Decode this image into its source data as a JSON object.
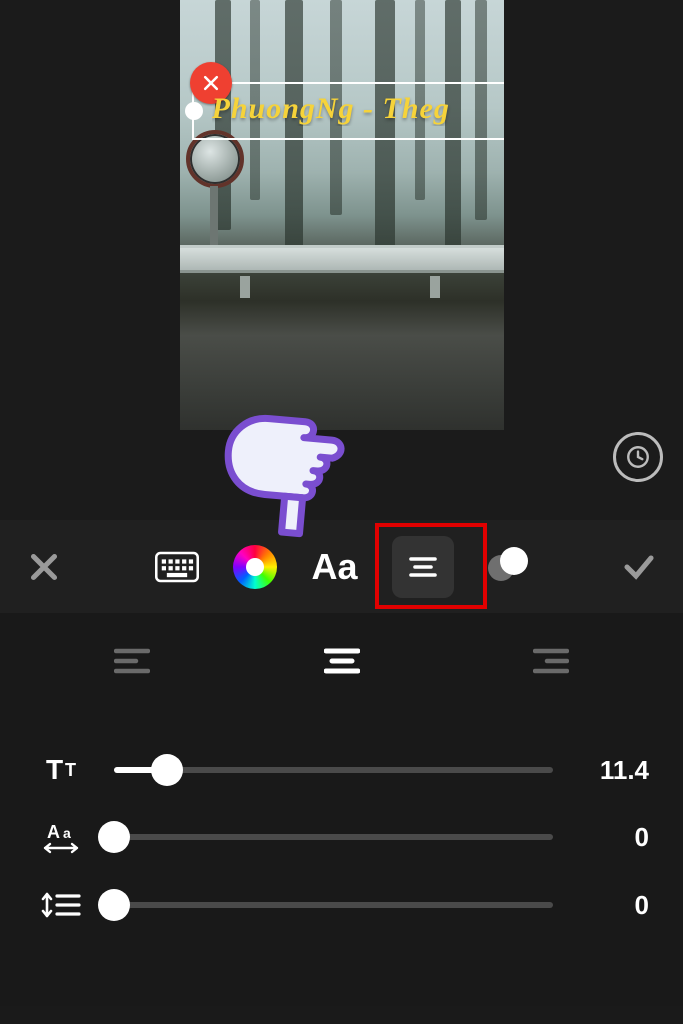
{
  "overlay": {
    "text": "PhuongNg - Theg",
    "text_color": "#f6d33a"
  },
  "icons": {
    "close_overlay": "close-icon",
    "grip": "handle-icon",
    "hand_pointer": "pointing-hand-icon",
    "clock": "clock-icon",
    "toolbar_close": "close-icon",
    "keyboard": "keyboard-icon",
    "color_wheel": "color-wheel-icon",
    "font": "font-icon",
    "align": "align-center-icon",
    "opacity": "opacity-icon",
    "confirm": "checkmark-icon",
    "align_left": "align-left-icon",
    "align_center": "align-center-icon",
    "align_right": "align-right-icon",
    "text_size": "text-size-icon",
    "letter_spacing": "letter-spacing-icon",
    "line_height": "line-height-icon"
  },
  "toolbar": {
    "font_label": "Aa"
  },
  "alignment": {
    "selected": "center"
  },
  "sliders": {
    "text_size": {
      "value": "11.4",
      "percent": 12
    },
    "letter_spacing": {
      "value": "0",
      "percent": 0
    },
    "line_height": {
      "value": "0",
      "percent": 0
    }
  },
  "annotation": {
    "highlight_target": "align-button"
  }
}
